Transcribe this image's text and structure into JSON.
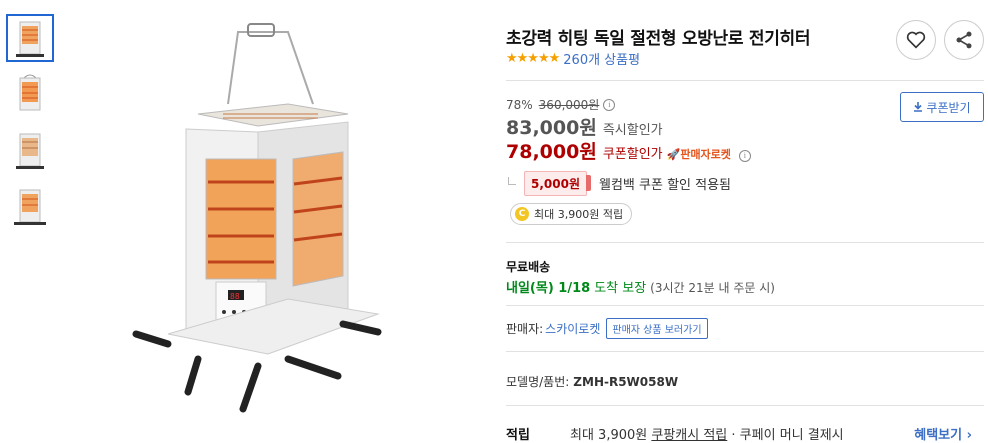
{
  "product": {
    "title": "초강력 히팅 독일 절전형 오방난로 전기히터",
    "stars": "★★★★★",
    "review_count": "260개 상품평"
  },
  "pricing": {
    "discount_rate": "78%",
    "original_price": "360,000원",
    "instant_price": "83,000원",
    "instant_label": "즉시할인가",
    "coupon_price": "78,000원",
    "coupon_label": "쿠폰할인가",
    "seller_rocket": "🚀판매자로켓",
    "coupon_button": "쿠폰받기"
  },
  "welcome": {
    "amount": "5,000원",
    "text": "웰컴백 쿠폰 할인 적용됨"
  },
  "reward": {
    "coin": "C",
    "text": "최대 3,900원 적립"
  },
  "shipping": {
    "title": "무료배송",
    "date": "내일(목) 1/18",
    "guarantee": "도착 보장",
    "note": "(3시간 21분 내 주문 시)"
  },
  "seller": {
    "label": "판매자:",
    "name": "스카이로켓",
    "button": "판매자 상품 보러가기"
  },
  "model": {
    "label": "모델명/품번:",
    "value": "ZMH-R5W058W"
  },
  "points": {
    "label": "적립",
    "text_a": "최대 3,900원 ",
    "text_b": "쿠팡캐시 적립",
    "text_c": " · 쿠페이 머니 결제시",
    "more": "혜택보기 ›"
  },
  "icons": {
    "wishlist": "heart-icon",
    "share": "share-icon",
    "info": "i"
  },
  "colors": {
    "accent_blue": "#3c6fc5",
    "price_red": "#ae0000",
    "delivery_green": "#00891a",
    "star_orange": "#f5a000"
  }
}
